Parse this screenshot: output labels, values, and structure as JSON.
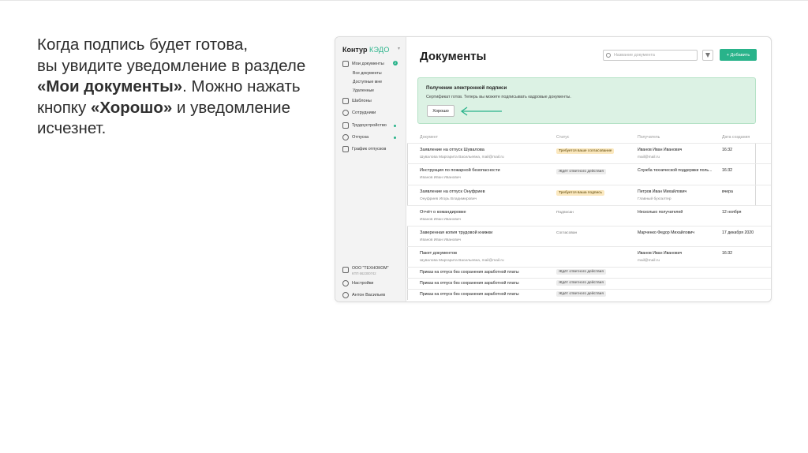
{
  "caption": {
    "line1": "Когда подпись будет готова,",
    "line2": "вы увидите уведомление в разделе",
    "line3_bold": "«Мои документы»",
    "line3_rest": ". Можно нажать",
    "line4_pre": "кнопку ",
    "line4_bold": "«Хорошо»",
    "line4_rest": " и уведомление",
    "line5": "исчезнет."
  },
  "app": {
    "logo_brand": "Контур",
    "logo_product": "КЭДО",
    "sidebar": {
      "my_docs": "Мои документы",
      "my_docs_badge": "2",
      "sub_all": "Все документы",
      "sub_available": "Доступные мне",
      "sub_deleted": "Удаленные",
      "templates": "Шаблоны",
      "employees": "Сотрудники",
      "employment": "Трудоустройство",
      "vacations": "Отпуска",
      "vacation_schedule": "График отпусков",
      "org_name": "ООО \"ТЕХНОКОМ\"",
      "org_sub": "КПП 662300742",
      "settings": "Настройки",
      "user": "Антон Васильев"
    },
    "header": {
      "title": "Документы",
      "search_placeholder": "Название документа",
      "add_label": "+ Добавить"
    },
    "notice": {
      "title": "Получение электронной подписи",
      "text": "Сертификат готов. Теперь вы можете подписывать кадровые документы.",
      "ok_label": "Хорошо"
    },
    "table": {
      "col_document": "Документ",
      "col_status": "Статус",
      "col_recipient": "Получатель",
      "col_date": "Дата создания",
      "rows": [
        {
          "name": "Заявление на отпуск Шувалова",
          "author": "Шувалова Маргарита Васильевна, mail@mail.ru",
          "status": "Требуется ваше согласование",
          "recipient": "Иванов Иван Иванович",
          "recipient_role": "mail@mail.ru",
          "date": "16:32"
        },
        {
          "name": "Инструкция по пожарной безопасности",
          "author": "Иванов Иван Иванович",
          "status": "Ждёт ответного действия",
          "recipient": "Служба технической поддержки поль...",
          "recipient_role": "",
          "date": "16:32"
        },
        {
          "name": "Заявление на отпуск Онуфриев",
          "author": "Онуфриев Игорь Владимирович",
          "status": "Требуется ваша подпись",
          "recipient": "Петров Иван Михайлович",
          "recipient_role": "Главный бухгалтер",
          "date": "вчера"
        },
        {
          "name": "Отчёт о командировке",
          "author": "Иванов Иван Иванович",
          "status": "Подписан",
          "recipient": "Несколько получателей",
          "recipient_role": "",
          "date": "12 ноября"
        },
        {
          "name": "Заверенная копия трудовой книжки",
          "author": "Иванов Иван Иванович",
          "status": "Согласован",
          "recipient": "Марченко Федор Михайлович",
          "recipient_role": "",
          "date": "17 декабря 2020"
        },
        {
          "name": "Пакет документов",
          "author": "Шувалова Маргарита Васильевна, mail@mail.ru",
          "status": "",
          "recipient": "Иванов Иван Иванович",
          "recipient_role": "mail@mail.ru",
          "date": "16:32"
        },
        {
          "name": "Приказ на отпуск без сохранения заработной платы",
          "author": "",
          "status": "Ждёт ответного действия",
          "recipient": "",
          "recipient_role": "",
          "date": ""
        },
        {
          "name": "Приказ на отпуск без сохранения заработной платы",
          "author": "",
          "status": "Ждёт ответного действия",
          "recipient": "",
          "recipient_role": "",
          "date": ""
        },
        {
          "name": "Приказ на отпуск без сохранения заработной платы",
          "author": "",
          "status": "Ждёт ответного действия",
          "recipient": "",
          "recipient_role": "",
          "date": ""
        }
      ]
    },
    "colors": {
      "accent": "#29b38a",
      "notice_bg": "#dcf2e4",
      "warn_badge": "#fbe8bf"
    }
  }
}
